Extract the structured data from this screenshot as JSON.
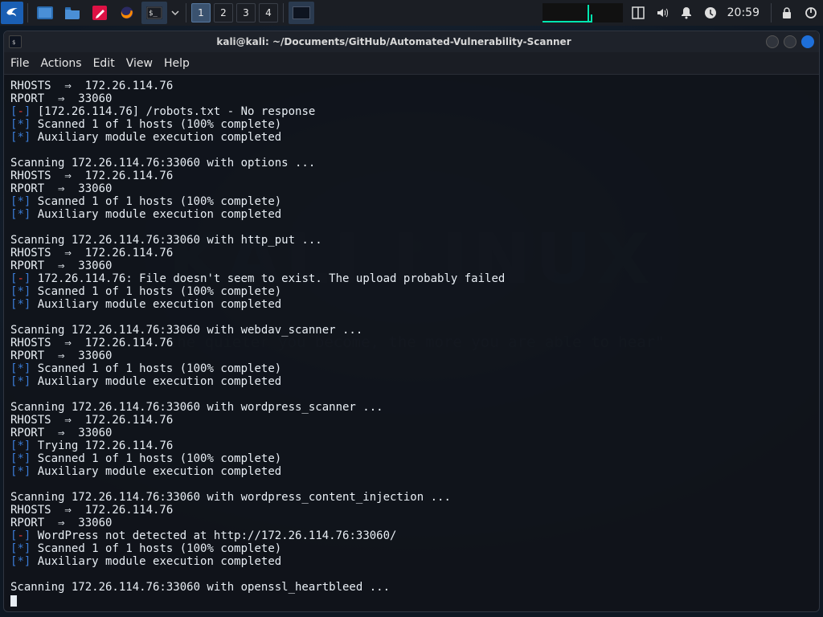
{
  "taskbar": {
    "workspaces": [
      "1",
      "2",
      "3",
      "4"
    ],
    "active_workspace": 0,
    "clock": "20:59"
  },
  "window": {
    "title": "kali@kali: ~/Documents/GitHub/Automated-Vulnerability-Scanner"
  },
  "menu": {
    "file": "File",
    "actions": "Actions",
    "edit": "Edit",
    "view": "View",
    "help": "Help"
  },
  "watermark": {
    "logo_text": "KALI LINUX",
    "quote": "\"the quieter you become, the more you are able to hear\""
  },
  "terminal_lines": [
    {
      "segs": [
        {
          "t": "RHOSTS  ⇒  172.26.114.76"
        }
      ]
    },
    {
      "segs": [
        {
          "t": "RPORT  ⇒  33060"
        }
      ]
    },
    {
      "segs": [
        {
          "t": "[",
          "c": "blue"
        },
        {
          "t": "-",
          "c": "red"
        },
        {
          "t": "]",
          "c": "blue"
        },
        {
          "t": " [172.26.114.76] /robots.txt - No response"
        }
      ]
    },
    {
      "segs": [
        {
          "t": "[",
          "c": "blue"
        },
        {
          "t": "*",
          "c": "blue"
        },
        {
          "t": "]",
          "c": "blue"
        },
        {
          "t": " Scanned 1 of 1 hosts (100% complete)"
        }
      ]
    },
    {
      "segs": [
        {
          "t": "[",
          "c": "blue"
        },
        {
          "t": "*",
          "c": "blue"
        },
        {
          "t": "]",
          "c": "blue"
        },
        {
          "t": " Auxiliary module execution completed"
        }
      ]
    },
    {
      "segs": [
        {
          "t": ""
        }
      ]
    },
    {
      "segs": [
        {
          "t": "Scanning 172.26.114.76:33060 with options ..."
        }
      ]
    },
    {
      "segs": [
        {
          "t": "RHOSTS  ⇒  172.26.114.76"
        }
      ]
    },
    {
      "segs": [
        {
          "t": "RPORT  ⇒  33060"
        }
      ]
    },
    {
      "segs": [
        {
          "t": "[",
          "c": "blue"
        },
        {
          "t": "*",
          "c": "blue"
        },
        {
          "t": "]",
          "c": "blue"
        },
        {
          "t": " Scanned 1 of 1 hosts (100% complete)"
        }
      ]
    },
    {
      "segs": [
        {
          "t": "[",
          "c": "blue"
        },
        {
          "t": "*",
          "c": "blue"
        },
        {
          "t": "]",
          "c": "blue"
        },
        {
          "t": " Auxiliary module execution completed"
        }
      ]
    },
    {
      "segs": [
        {
          "t": ""
        }
      ]
    },
    {
      "segs": [
        {
          "t": "Scanning 172.26.114.76:33060 with http_put ..."
        }
      ]
    },
    {
      "segs": [
        {
          "t": "RHOSTS  ⇒  172.26.114.76"
        }
      ]
    },
    {
      "segs": [
        {
          "t": "RPORT  ⇒  33060"
        }
      ]
    },
    {
      "segs": [
        {
          "t": "[",
          "c": "blue"
        },
        {
          "t": "-",
          "c": "red"
        },
        {
          "t": "]",
          "c": "blue"
        },
        {
          "t": " 172.26.114.76: File doesn't seem to exist. The upload probably failed"
        }
      ]
    },
    {
      "segs": [
        {
          "t": "[",
          "c": "blue"
        },
        {
          "t": "*",
          "c": "blue"
        },
        {
          "t": "]",
          "c": "blue"
        },
        {
          "t": " Scanned 1 of 1 hosts (100% complete)"
        }
      ]
    },
    {
      "segs": [
        {
          "t": "[",
          "c": "blue"
        },
        {
          "t": "*",
          "c": "blue"
        },
        {
          "t": "]",
          "c": "blue"
        },
        {
          "t": " Auxiliary module execution completed"
        }
      ]
    },
    {
      "segs": [
        {
          "t": ""
        }
      ]
    },
    {
      "segs": [
        {
          "t": "Scanning 172.26.114.76:33060 with webdav_scanner ..."
        }
      ]
    },
    {
      "segs": [
        {
          "t": "RHOSTS  ⇒  172.26.114.76"
        }
      ]
    },
    {
      "segs": [
        {
          "t": "RPORT  ⇒  33060"
        }
      ]
    },
    {
      "segs": [
        {
          "t": "[",
          "c": "blue"
        },
        {
          "t": "*",
          "c": "blue"
        },
        {
          "t": "]",
          "c": "blue"
        },
        {
          "t": " Scanned 1 of 1 hosts (100% complete)"
        }
      ]
    },
    {
      "segs": [
        {
          "t": "[",
          "c": "blue"
        },
        {
          "t": "*",
          "c": "blue"
        },
        {
          "t": "]",
          "c": "blue"
        },
        {
          "t": " Auxiliary module execution completed"
        }
      ]
    },
    {
      "segs": [
        {
          "t": ""
        }
      ]
    },
    {
      "segs": [
        {
          "t": "Scanning 172.26.114.76:33060 with wordpress_scanner ..."
        }
      ]
    },
    {
      "segs": [
        {
          "t": "RHOSTS  ⇒  172.26.114.76"
        }
      ]
    },
    {
      "segs": [
        {
          "t": "RPORT  ⇒  33060"
        }
      ]
    },
    {
      "segs": [
        {
          "t": "[",
          "c": "blue"
        },
        {
          "t": "*",
          "c": "blue"
        },
        {
          "t": "]",
          "c": "blue"
        },
        {
          "t": " Trying 172.26.114.76"
        }
      ]
    },
    {
      "segs": [
        {
          "t": "[",
          "c": "blue"
        },
        {
          "t": "*",
          "c": "blue"
        },
        {
          "t": "]",
          "c": "blue"
        },
        {
          "t": " Scanned 1 of 1 hosts (100% complete)"
        }
      ]
    },
    {
      "segs": [
        {
          "t": "[",
          "c": "blue"
        },
        {
          "t": "*",
          "c": "blue"
        },
        {
          "t": "]",
          "c": "blue"
        },
        {
          "t": " Auxiliary module execution completed"
        }
      ]
    },
    {
      "segs": [
        {
          "t": ""
        }
      ]
    },
    {
      "segs": [
        {
          "t": "Scanning 172.26.114.76:33060 with wordpress_content_injection ..."
        }
      ]
    },
    {
      "segs": [
        {
          "t": "RHOSTS  ⇒  172.26.114.76"
        }
      ]
    },
    {
      "segs": [
        {
          "t": "RPORT  ⇒  33060"
        }
      ]
    },
    {
      "segs": [
        {
          "t": "[",
          "c": "blue"
        },
        {
          "t": "-",
          "c": "red"
        },
        {
          "t": "]",
          "c": "blue"
        },
        {
          "t": " WordPress not detected at http://172.26.114.76:33060/"
        }
      ]
    },
    {
      "segs": [
        {
          "t": "[",
          "c": "blue"
        },
        {
          "t": "*",
          "c": "blue"
        },
        {
          "t": "]",
          "c": "blue"
        },
        {
          "t": " Scanned 1 of 1 hosts (100% complete)"
        }
      ]
    },
    {
      "segs": [
        {
          "t": "[",
          "c": "blue"
        },
        {
          "t": "*",
          "c": "blue"
        },
        {
          "t": "]",
          "c": "blue"
        },
        {
          "t": " Auxiliary module execution completed"
        }
      ]
    },
    {
      "segs": [
        {
          "t": ""
        }
      ]
    },
    {
      "segs": [
        {
          "t": "Scanning 172.26.114.76:33060 with openssl_heartbleed ..."
        }
      ]
    }
  ]
}
